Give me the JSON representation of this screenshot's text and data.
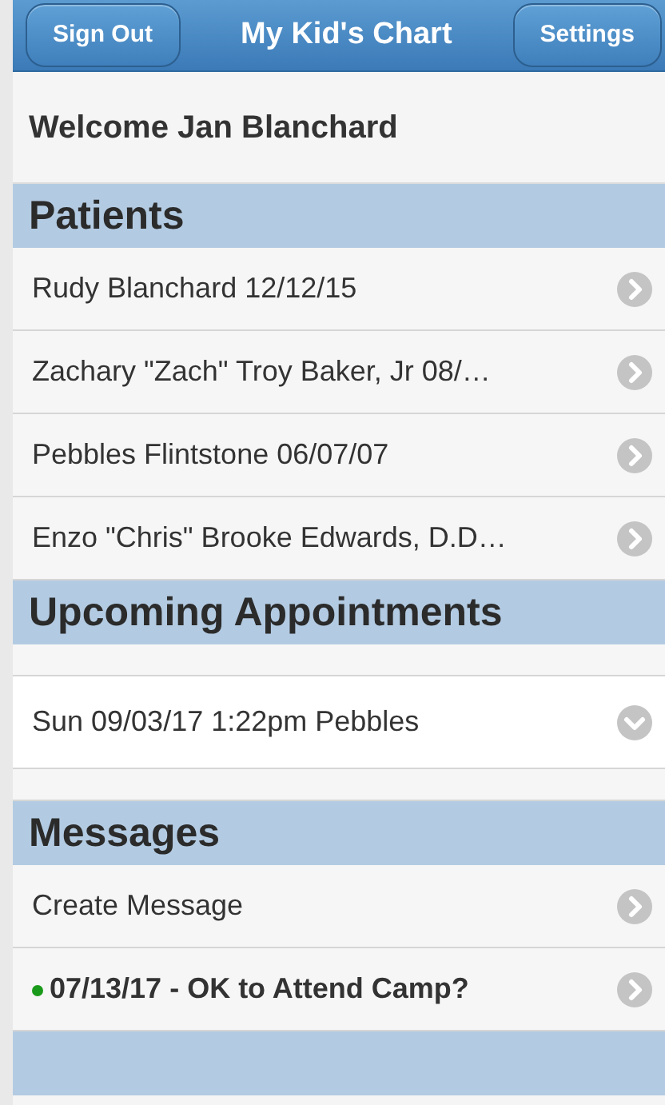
{
  "header": {
    "left_button": "Sign Out",
    "title": "My Kid's Chart",
    "right_button": "Settings"
  },
  "welcome": "Welcome Jan Blanchard",
  "patients": {
    "title": "Patients",
    "items": [
      {
        "label": "Rudy Blanchard 12/12/15"
      },
      {
        "label": "Zachary \"Zach\" Troy Baker, Jr 08/…"
      },
      {
        "label": "Pebbles Flintstone 06/07/07"
      },
      {
        "label": "Enzo \"Chris\" Brooke Edwards, D.D…"
      }
    ]
  },
  "appointments": {
    "title": "Upcoming Appointments",
    "items": [
      {
        "label": "Sun 09/03/17 1:22pm Pebbles"
      }
    ]
  },
  "messages": {
    "title": "Messages",
    "items": [
      {
        "label": "Create Message",
        "unread": false
      },
      {
        "label": "07/13/17 - OK to Attend Camp?",
        "unread": true,
        "color": "#1a9a1a"
      }
    ]
  }
}
